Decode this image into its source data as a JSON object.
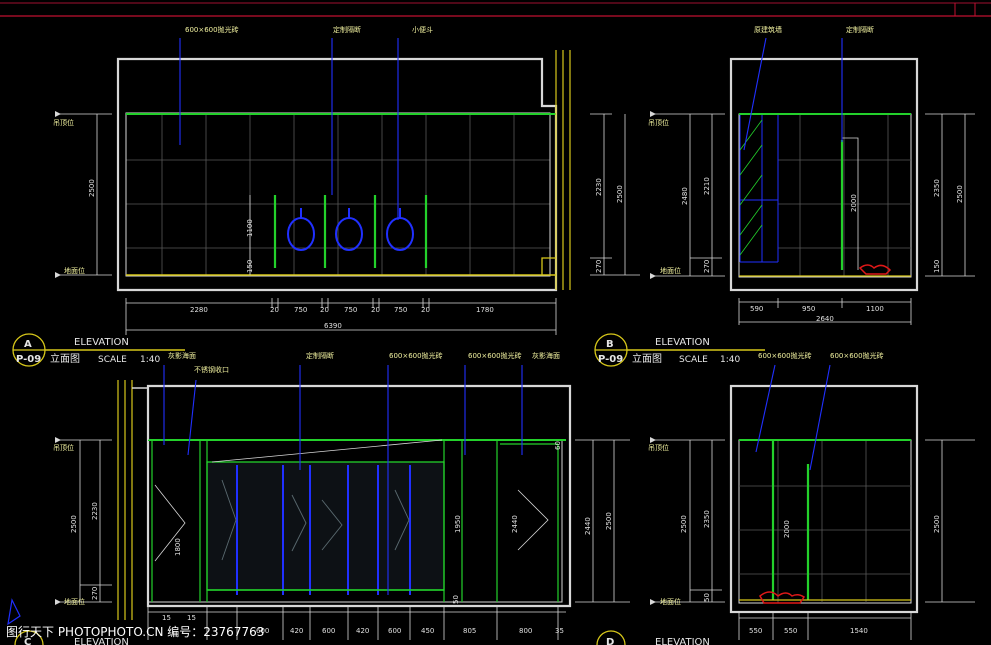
{
  "colors": {
    "frame": "#d8d8d8",
    "green": "#23d12b",
    "blue": "#2030ff",
    "grid": "#5a5a5a",
    "dim": "#c8c8c8",
    "yellow": "#d8c81a",
    "red": "#e01818",
    "header": "#c01030"
  },
  "panel_a": {
    "callouts": [
      "600×600抛光砖",
      "定制隔断",
      "小便斗"
    ],
    "levels": [
      "吊顶位",
      "地面位"
    ],
    "vdims_left": [
      "2500",
      "1100",
      "150"
    ],
    "vdims_right": [
      "2230",
      "2500",
      "270"
    ],
    "hdims": [
      "2280",
      "20",
      "750",
      "20",
      "750",
      "20",
      "750",
      "20",
      "1780"
    ],
    "total": "6390",
    "title": {
      "letter": "A",
      "sheet": "P-09",
      "elevation": "ELEVATION",
      "name": "立面图",
      "scale_label": "SCALE",
      "scale": "1:40"
    }
  },
  "panel_b": {
    "callouts": [
      "原建筑墙",
      "定制隔断"
    ],
    "levels": [
      "吊顶位",
      "地面位"
    ],
    "vdims_left": [
      "2480",
      "2210",
      "270"
    ],
    "vdims_inner": [
      "2000"
    ],
    "vdims_right": [
      "2350",
      "2500",
      "150"
    ],
    "hdims": [
      "590",
      "950",
      "1100"
    ],
    "total": "2640",
    "title": {
      "letter": "B",
      "sheet": "P-09",
      "elevation": "ELEVATION",
      "name": "立面图",
      "scale_label": "SCALE",
      "scale": "1:40"
    }
  },
  "panel_c": {
    "callouts": [
      "灰影海面",
      "不锈钢收口",
      "定制隔断",
      "600×600抛光砖",
      "600×600抛光砖",
      "灰影海面"
    ],
    "levels": [
      "吊顶位",
      "地面位"
    ],
    "vdims_left": [
      "2500",
      "2230",
      "270"
    ],
    "vdims_inner": [
      "1800",
      "1950",
      "2440",
      "60"
    ],
    "vdims_right": [
      "2440",
      "2500",
      "50"
    ],
    "hdims_top": [
      "15",
      "15"
    ],
    "hdims": [
      "600",
      "420",
      "600",
      "420",
      "600",
      "450",
      "805",
      "800",
      "35"
    ],
    "title": {
      "letter": "C",
      "elevation": "ELEVATION"
    }
  },
  "panel_d": {
    "callouts": [
      "600×600抛光砖",
      "600×600抛光砖"
    ],
    "levels": [
      "吊顶位",
      "地面位"
    ],
    "vdims_left": [
      "2500",
      "2350",
      "50"
    ],
    "vdims_inner": [
      "2000"
    ],
    "vdims_right": [
      "2500"
    ],
    "hdims": [
      "550",
      "550",
      "1540"
    ],
    "title": {
      "letter": "D",
      "elevation": "ELEVATION"
    }
  },
  "watermark": "图行天下 PHOTOPHOTO.CN 编号：23767763"
}
